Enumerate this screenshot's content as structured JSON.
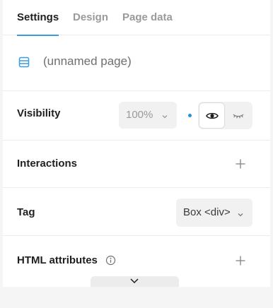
{
  "tabs": [
    {
      "label": "Settings",
      "active": true
    },
    {
      "label": "Design",
      "active": false
    },
    {
      "label": "Page data",
      "active": false
    }
  ],
  "page": {
    "name": "(unnamed page)",
    "icon": "page-layout-icon"
  },
  "visibility": {
    "label": "Visibility",
    "opacity_value": "100%",
    "state": "visible",
    "indicator_color": "#2a8fd6",
    "options": [
      {
        "icon": "eye-open-icon",
        "selected": true
      },
      {
        "icon": "eye-closed-icon",
        "selected": false
      }
    ]
  },
  "interactions": {
    "label": "Interactions",
    "icon": "plus-icon"
  },
  "tag": {
    "label": "Tag",
    "value": "Box <div>"
  },
  "html_attributes": {
    "label": "HTML attributes",
    "info_icon": "info-icon",
    "icon": "plus-icon"
  },
  "colors": {
    "accent": "#3b9be0",
    "panel": "#ffffff",
    "background": "#f5f5f5"
  }
}
